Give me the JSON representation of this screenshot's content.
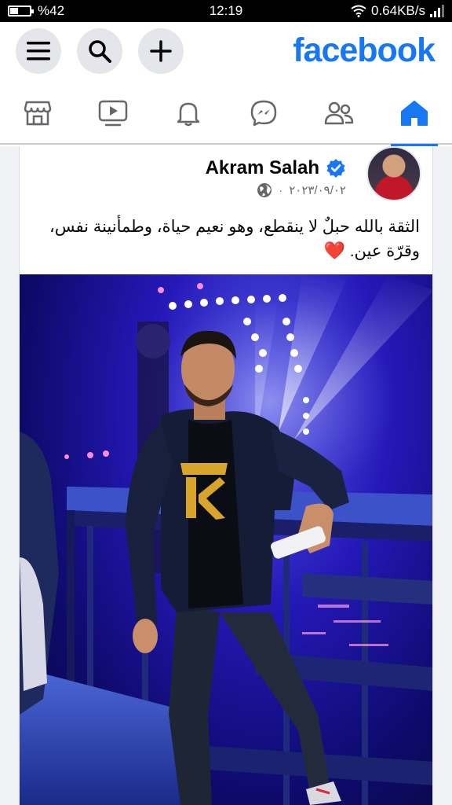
{
  "status_bar": {
    "battery_percent": "%42",
    "battery_level": 0.42,
    "time": "12:19",
    "network_speed": "0.64KB/s"
  },
  "header": {
    "logo": "facebook",
    "buttons": [
      {
        "icon": "menu-icon"
      },
      {
        "icon": "search-icon"
      },
      {
        "icon": "plus-icon"
      }
    ]
  },
  "nav": {
    "items": [
      {
        "icon": "marketplace-icon",
        "active": false
      },
      {
        "icon": "video-icon",
        "active": false
      },
      {
        "icon": "bell-icon",
        "active": false
      },
      {
        "icon": "messenger-icon",
        "active": false
      },
      {
        "icon": "friends-icon",
        "active": false
      },
      {
        "icon": "home-icon",
        "active": true
      }
    ]
  },
  "post": {
    "author": "Akram Salah",
    "verified": true,
    "date": "٢٠٢٣/٠٩/٠٢",
    "separator": "·",
    "privacy_icon": "globe-icon",
    "text": "الثقة بالله حبلٌ لا ينقطع، وهو نعيم حياة، وطمأنينة نفس، وقرّة عين.",
    "emoji": "❤️"
  },
  "colors": {
    "brand": "#1877f2",
    "icon_gray": "#65676b",
    "heart": "#f02849"
  }
}
